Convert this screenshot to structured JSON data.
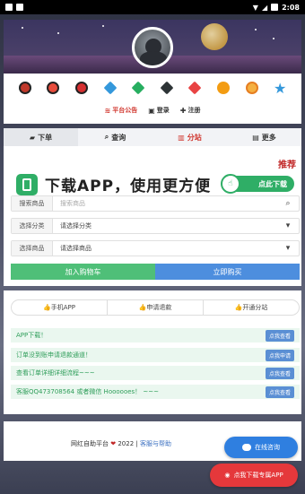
{
  "status": {
    "time": "2:08"
  },
  "top_links": [
    {
      "label": "平台公告",
      "icon": "wifi-icon"
    },
    {
      "label": "登录",
      "icon": "user-icon"
    },
    {
      "label": "注册",
      "icon": "plus-icon"
    }
  ],
  "level_icons": [
    "red-bomb-icon",
    "red-bomb-icon",
    "red-bomb-icon",
    "blue-diamond-icon",
    "green-diamond-icon",
    "black-diamond-icon",
    "red-diamond-icon",
    "orange-burst-icon",
    "orange-swirl-icon",
    "blue-star-icon"
  ],
  "tabs": [
    {
      "label": "下单",
      "icon": "bag-icon"
    },
    {
      "label": "查询",
      "icon": "search-icon"
    },
    {
      "label": "分站",
      "icon": "shop-icon"
    },
    {
      "label": "更多",
      "icon": "folder-icon"
    }
  ],
  "recommend": "推荐",
  "download": {
    "text": "下载APP，使用更方便",
    "button": "点此下载"
  },
  "form": {
    "search": {
      "label": "搜索商品",
      "placeholder": "搜索商品"
    },
    "category": {
      "label": "选择分类",
      "value": "请选择分类"
    },
    "product": {
      "label": "选择商品",
      "value": "请选择商品"
    },
    "add_cart": "加入购物车",
    "buy_now": "立即购买"
  },
  "segments": [
    "手机APP",
    "申请退款",
    "开通分站"
  ],
  "notices": [
    {
      "text": "APP下载！",
      "button": "点我查看"
    },
    {
      "text": "订单没到账申请退款通道！",
      "button": "点我申请"
    },
    {
      "text": "查看订单详细详细流程~~~",
      "button": "点我查看"
    },
    {
      "text": "客服QQ473708564 或者微信 Hoooooes！ ~~~",
      "button": "点我查看"
    }
  ],
  "footer": {
    "brand": "网红自助平台",
    "year": "2022",
    "sep": "|",
    "link": "客服与帮助"
  },
  "float": {
    "chat": "在线咨询",
    "apk": "点我下载专属APP"
  },
  "colors": {
    "accent_red": "#d0352d",
    "green": "#2fae66",
    "blue": "#4d8ede"
  }
}
